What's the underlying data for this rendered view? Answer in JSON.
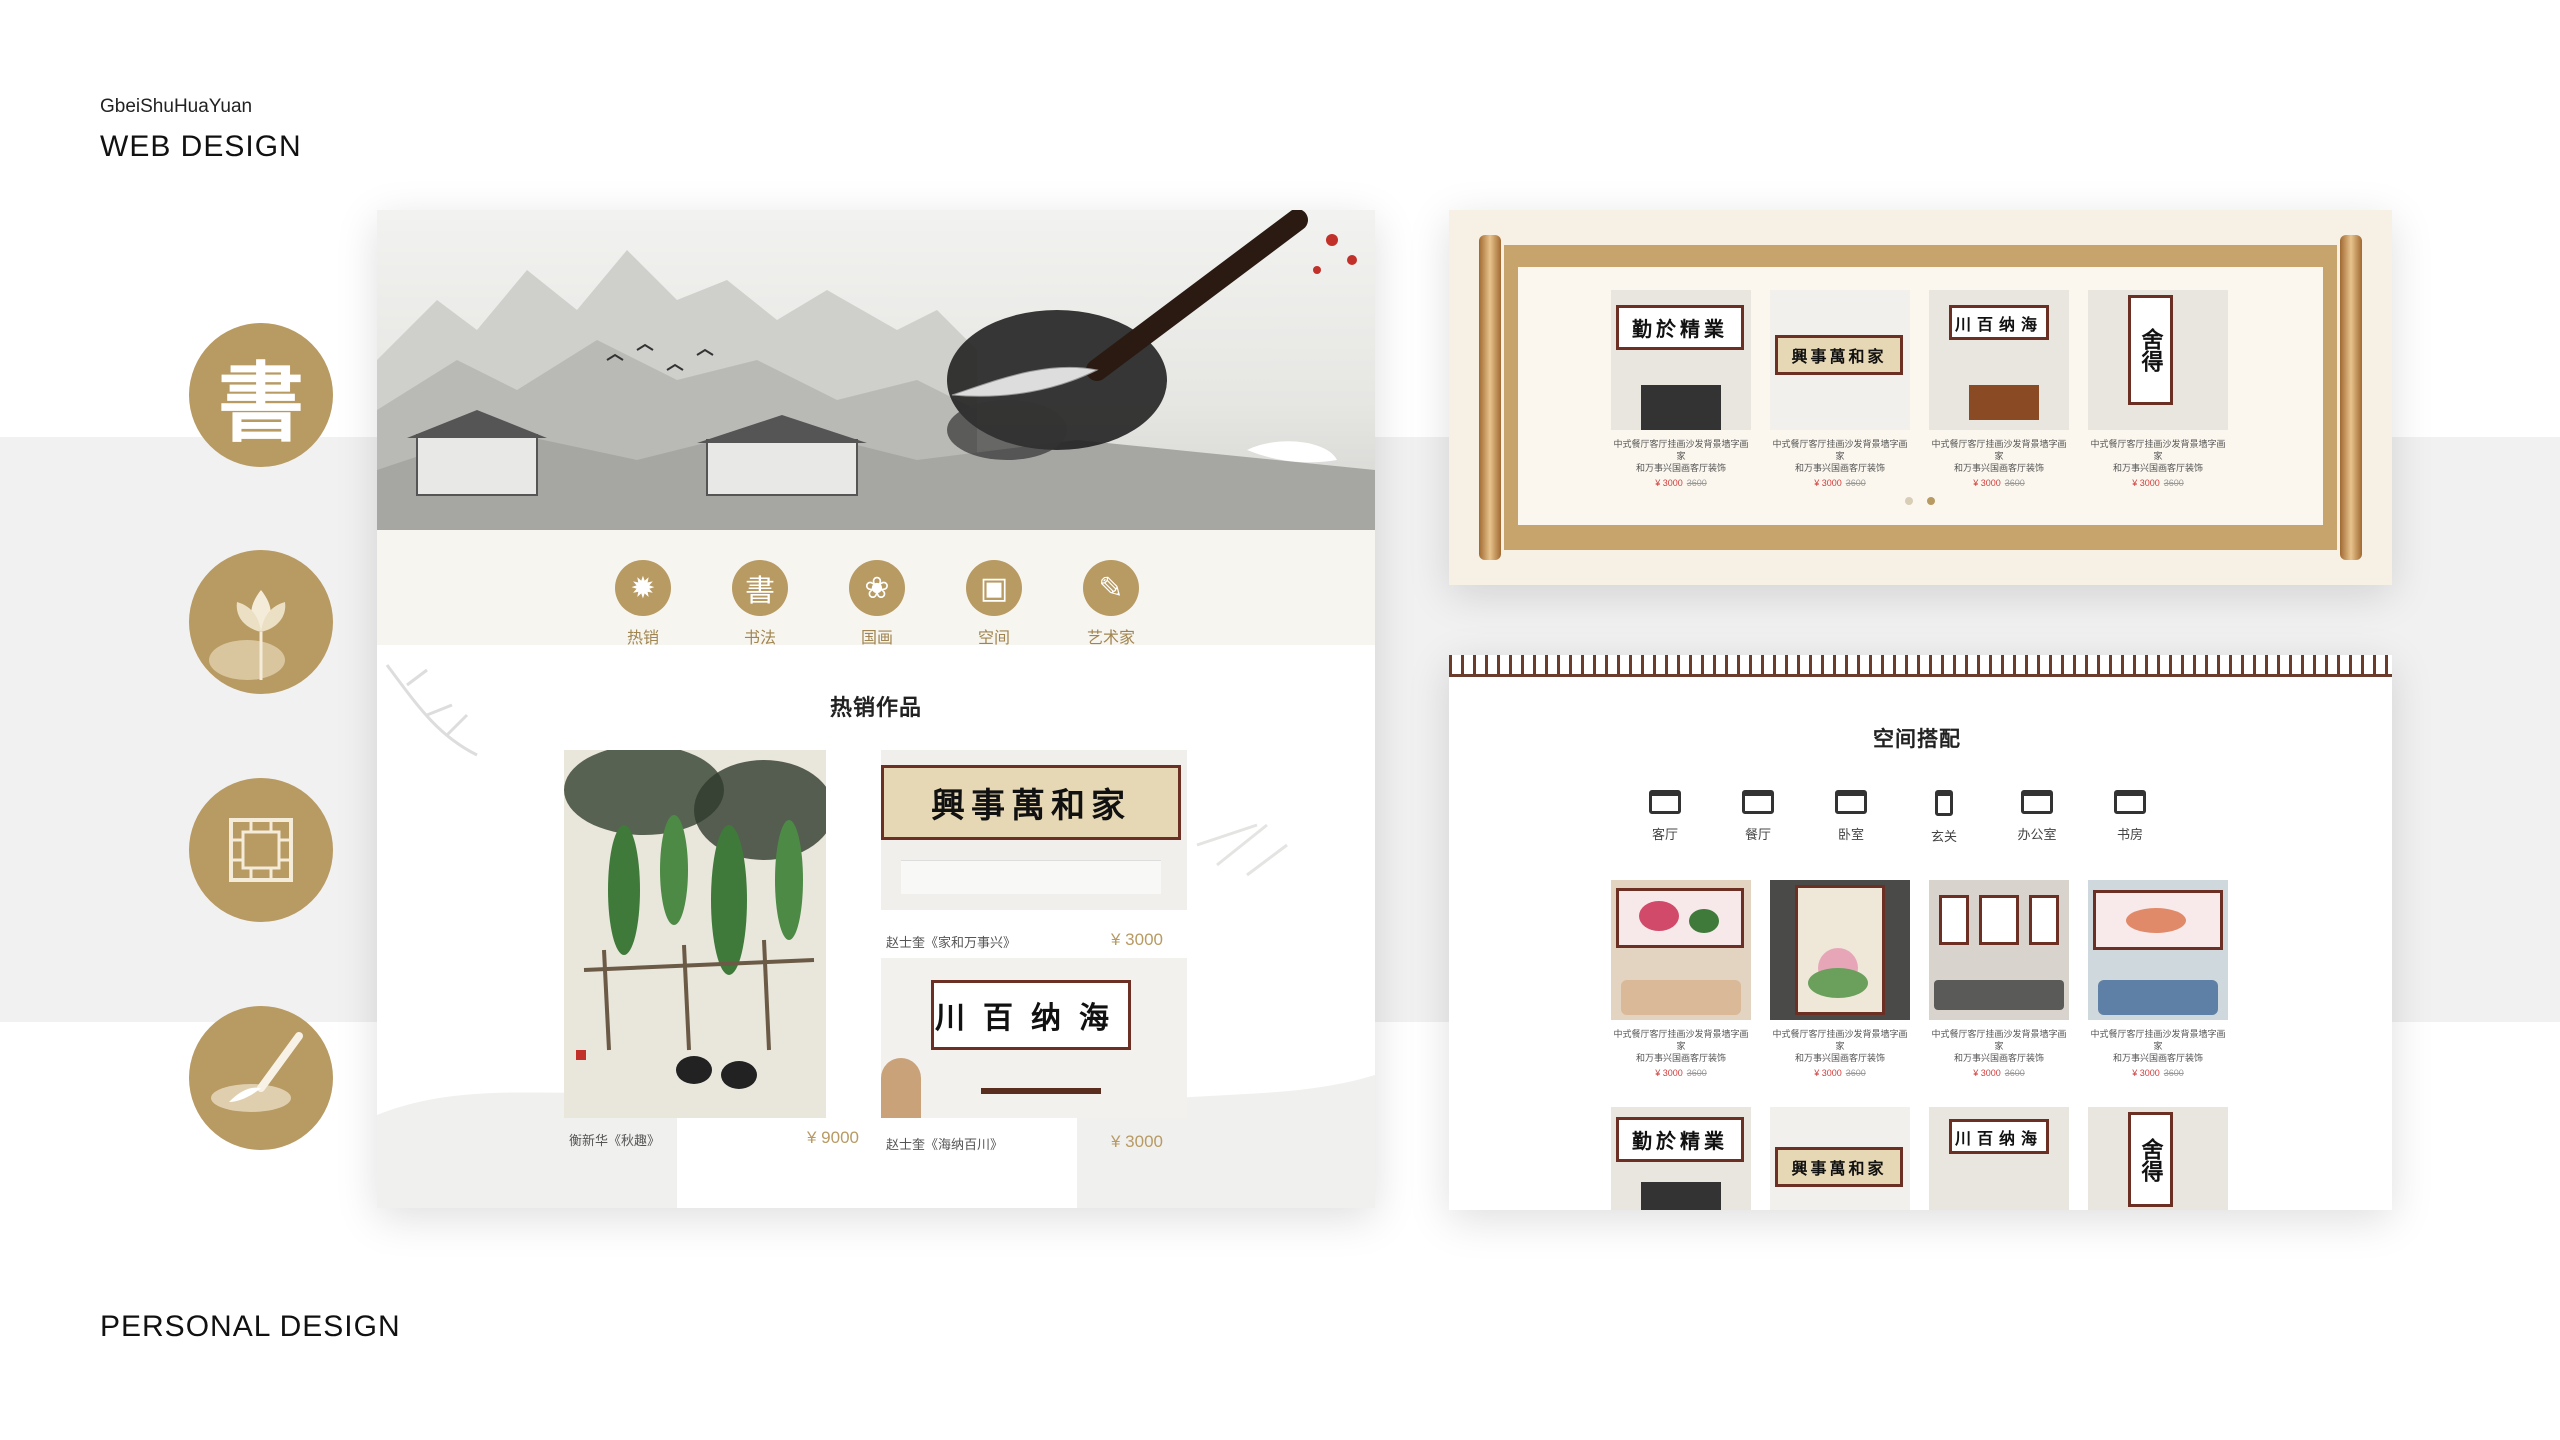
{
  "brand": {
    "small": "GbeiShuHuaYuan",
    "title": "WEB DESIGN",
    "footer": "PERSONAL DESIGN"
  },
  "side_icons": [
    {
      "char": "書",
      "icon": "calligraphy-char-icon"
    },
    {
      "icon": "lotus-icon"
    },
    {
      "icon": "window-lattice-icon"
    },
    {
      "icon": "brush-icon"
    }
  ],
  "left_page": {
    "nav": [
      {
        "label": "热销",
        "glyph": "✹",
        "icon": "fire-icon"
      },
      {
        "label": "书法",
        "glyph": "書",
        "icon": "calligraphy-icon"
      },
      {
        "label": "国画",
        "glyph": "❀",
        "icon": "lotus-icon"
      },
      {
        "label": "空间",
        "glyph": "▣",
        "icon": "window-icon"
      },
      {
        "label": "艺术家",
        "glyph": "✎",
        "icon": "brush-icon"
      }
    ],
    "hot_title": "热销作品",
    "works": [
      {
        "caption": "衡新华《秋趣》",
        "price": "¥ 9000"
      },
      {
        "caption": "赵士奎《家和万事兴》",
        "price": "¥ 3000",
        "calligraphy": "興事萬和家"
      },
      {
        "caption": "赵士奎《海纳百川》",
        "price": "¥ 3000",
        "calligraphy": "川百纳海"
      }
    ]
  },
  "scroll_panel": {
    "products": [
      {
        "calligraphy": "勤於精業",
        "line1": "中式餐厅客厅挂画沙发背景墙字画家",
        "line2": "和万事兴国画客厅装饰",
        "price": "¥ 3000",
        "old_price": "3600"
      },
      {
        "calligraphy": "興事萬和家",
        "line1": "中式餐厅客厅挂画沙发背景墙字画家",
        "line2": "和万事兴国画客厅装饰",
        "price": "¥ 3000",
        "old_price": "3600"
      },
      {
        "calligraphy": "川百纳海",
        "line1": "中式餐厅客厅挂画沙发背景墙字画家",
        "line2": "和万事兴国画客厅装饰",
        "price": "¥ 3000",
        "old_price": "3600"
      },
      {
        "calligraphy": "舍得",
        "line1": "中式餐厅客厅挂画沙发背景墙字画家",
        "line2": "和万事兴国画客厅装饰",
        "price": "¥ 3000",
        "old_price": "3600"
      }
    ]
  },
  "space_panel": {
    "title": "空间搭配",
    "rooms": [
      "客厅",
      "餐厅",
      "卧室",
      "玄关",
      "办公室",
      "书房"
    ],
    "products": [
      {
        "line1": "中式餐厅客厅挂画沙发背景墙字画家",
        "line2": "和万事兴国画客厅装饰",
        "price": "¥ 3000",
        "old_price": "3600"
      },
      {
        "line1": "中式餐厅客厅挂画沙发背景墙字画家",
        "line2": "和万事兴国画客厅装饰",
        "price": "¥ 3000",
        "old_price": "3600"
      },
      {
        "line1": "中式餐厅客厅挂画沙发背景墙字画家",
        "line2": "和万事兴国画客厅装饰",
        "price": "¥ 3000",
        "old_price": "3600"
      },
      {
        "line1": "中式餐厅客厅挂画沙发背景墙字画家",
        "line2": "和万事兴国画客厅装饰",
        "price": "¥ 3000",
        "old_price": "3600"
      }
    ],
    "second_row": [
      "勤於精業",
      "興事萬和家",
      "川百纳海",
      "舍得"
    ]
  }
}
